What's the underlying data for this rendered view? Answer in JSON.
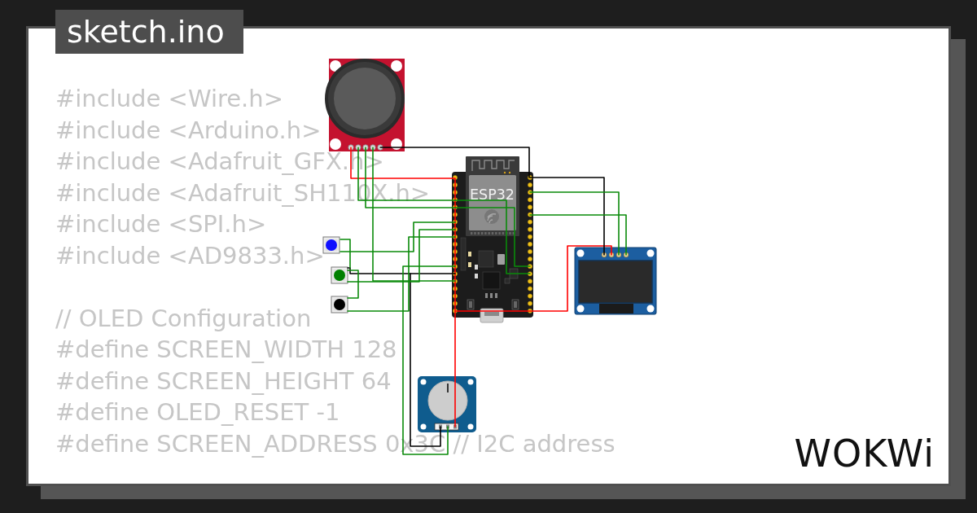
{
  "editor_tab": {
    "title": "sketch.ino"
  },
  "code": {
    "blocks": [
      [
        "#include <Wire.h>",
        "#include <Arduino.h>",
        "#include <Adafruit_GFX.h>",
        "#include <Adafruit_SH110X.h>",
        "#include <SPI.h>",
        "#include <AD9833.h>"
      ],
      [
        "// OLED Configuration",
        "#define SCREEN_WIDTH 128",
        "#define SCREEN_HEIGHT 64",
        "#define OLED_RESET -1",
        "#define SCREEN_ADDRESS 0x3C // I2C address"
      ]
    ]
  },
  "circuit": {
    "board": {
      "label": "ESP32"
    },
    "push_buttons": [
      {
        "color": "#1010ff"
      },
      {
        "color": "#008000"
      },
      {
        "color": "#000000"
      }
    ]
  },
  "logo": {
    "text": "WOKWi"
  }
}
